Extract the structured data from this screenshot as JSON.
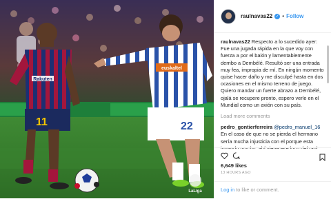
{
  "post": {
    "username": "raulnavas22",
    "follow_label": "Follow",
    "separator": "•",
    "caption": "Respecto a lo sucedido ayer: Fue una jugada rápida en la que voy con fuerza a por el balón y lamentablemente derribo a Dembélé. Resultó ser una entrada muy fea, impropia de mí. En ningún momento quise hacer daño y me disculpé hasta en dos ocasiones en el mismo terreno de juego. Quiero mandar un fuerte abrazo a Dembélé, ojalá se recupere pronto, espero verle en el Mundial como un avión con su país.",
    "load_more": "Load more comments",
    "comment": {
      "username": "pedro_gontierferreira",
      "mention": "@pedro_manuel_16",
      "text": "En el caso de que no se pierda el hermano sería mucha injusticia con el porque esta jugando mucho, ahí viene ese loco del raul"
    },
    "likes": "6,649 likes",
    "time": "13 HOURS AGO",
    "login_prefix": "",
    "login_link": "Log in",
    "login_suffix": " to like or comment."
  },
  "photo": {
    "watermark": "LaLiga",
    "sponsor": "Rakuten",
    "sponsor2": "euskaltel",
    "number_left": "11",
    "number_right": "22"
  },
  "icons": {
    "verified": "verified-badge-icon",
    "like": "heart-icon",
    "comment": "comment-icon",
    "save": "bookmark-icon",
    "more": "more-dots-icon"
  },
  "colors": {
    "accent": "#3897f0",
    "link": "#003569",
    "muted": "#999999",
    "text": "#262626"
  }
}
